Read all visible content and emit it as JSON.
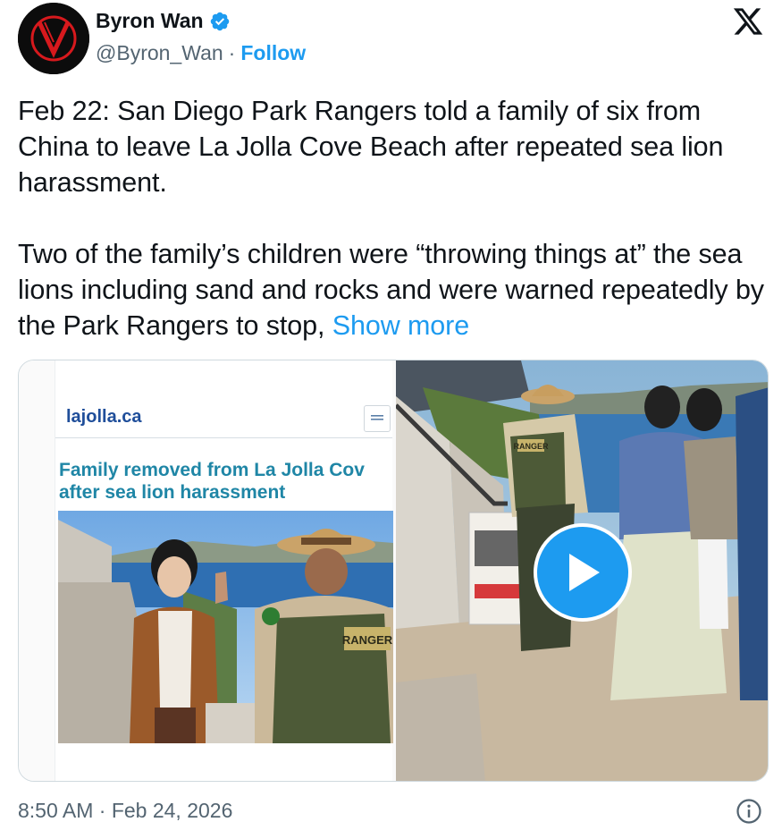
{
  "user": {
    "display_name": "Byron Wan",
    "handle": "@Byron_Wan",
    "separator": "·",
    "follow_label": "Follow"
  },
  "tweet": {
    "paragraph1": "Feb 22: San Diego Park Rangers told a family of six from China to leave La Jolla Cove Beach after repeated sea lion harassment.",
    "paragraph2": "Two of the family’s children were “throwing things at” the sea lions including sand and rocks and were warned repeatedly by the Park Rangers to stop,",
    "show_more": "Show more",
    "timestamp": "8:50 AM · Feb 24, 2026"
  },
  "media": {
    "site_name": "lajolla.ca",
    "headline_line1": "Family removed from La Jolla Cov",
    "headline_line2": "after sea lion harassment",
    "ranger_patch": "RANGER",
    "ranger_patch_small": "RANGER"
  },
  "colors": {
    "link_blue": "#1d9bf0",
    "text": "#0f1419",
    "secondary": "#536471",
    "border": "#cfd9de",
    "headline": "#1f86a6"
  },
  "icons": {
    "verified": "verified-badge-icon",
    "x_logo": "x-logo-icon",
    "play": "play-icon",
    "info": "info-icon"
  }
}
